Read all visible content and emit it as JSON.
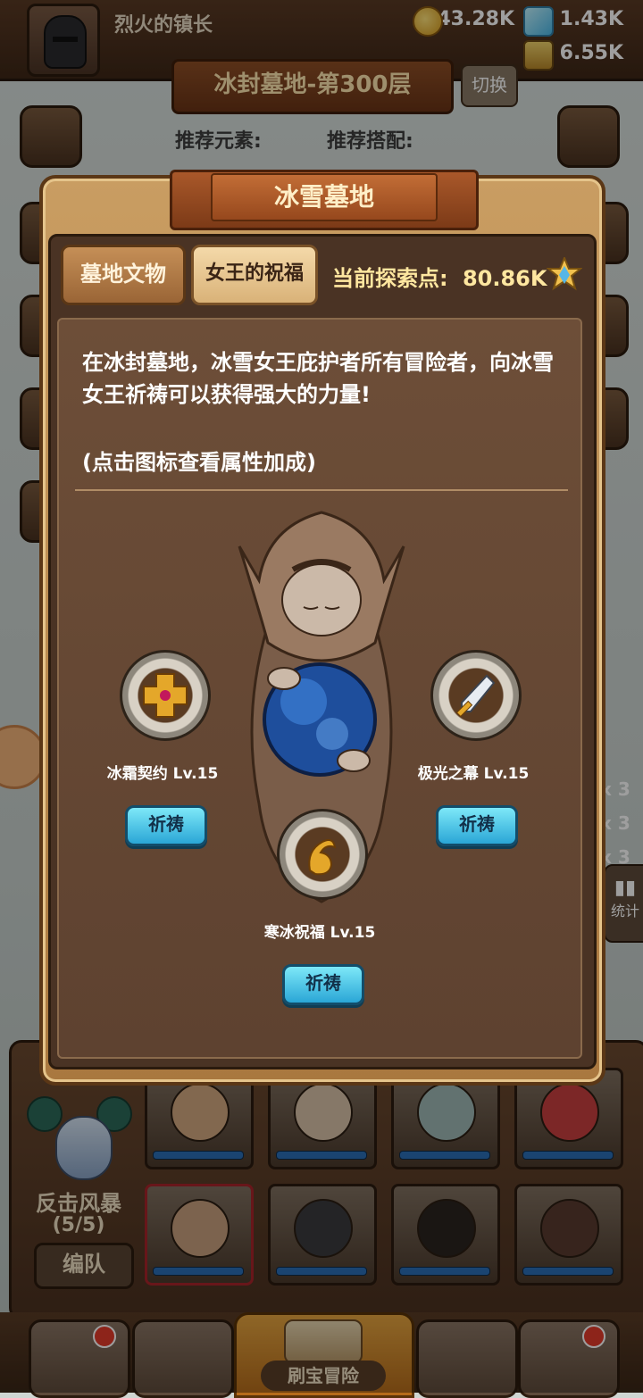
{
  "header": {
    "player_name": "烈火的镇长",
    "gold": "43.28K",
    "gems": "1.43K",
    "jar": "6.55K",
    "stage_title": "冰封墓地-第300层",
    "switch_label": "切换",
    "recommended_element": "推荐元素:",
    "recommended_combo": "推荐搭配:"
  },
  "side": {
    "stat_label": "统计",
    "counts": [
      "x 3",
      "x 3",
      "x 3"
    ]
  },
  "modal": {
    "title": "冰雪墓地",
    "tabs": [
      "墓地文物",
      "女王的祝福"
    ],
    "explore_label": "当前探索点:",
    "explore_value": "80.86K",
    "description": "在冰封墓地，冰雪女王庇护者所有冒险者，向冰雪女王祈祷可以获得强大的力量!",
    "hint": "(点击图标查看属性加成)",
    "blessings": [
      {
        "name": "冰霜契约 Lv.15",
        "button": "祈祷"
      },
      {
        "name": "极光之幕 Lv.15",
        "button": "祈祷"
      },
      {
        "name": "寒冰祝福 Lv.15",
        "button": "祈祷"
      }
    ]
  },
  "squad": {
    "team_name": "反击风暴",
    "team_count": "(5/5)",
    "team_button": "编队"
  },
  "nav": {
    "center_label": "刷宝冒险"
  },
  "colors": {
    "pray_button": "#2aa6d6",
    "panel_brown": "#4a3324",
    "gold_text": "#ffe7a0"
  }
}
